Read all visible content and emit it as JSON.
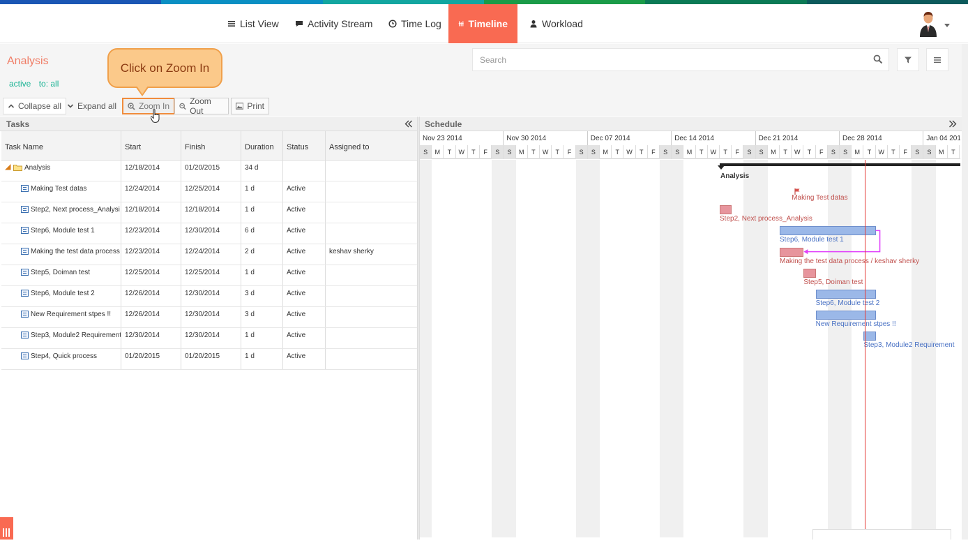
{
  "colors": {
    "stripe": [
      "#1a56b4",
      "#0a8fc3",
      "#12a6a0",
      "#1a9b48",
      "#0b7a55",
      "#0c5a5c"
    ],
    "accent": "#f96a52",
    "title": "#f07d66",
    "filter": "#1ab394",
    "task_bar_red": "#e7959d",
    "task_bar_blue": "#9bb8e8",
    "today_line": "#e53935"
  },
  "nav": {
    "items": [
      {
        "label": "List View",
        "icon": "list-icon"
      },
      {
        "label": "Activity Stream",
        "icon": "comment-icon"
      },
      {
        "label": "Time Log",
        "icon": "clock-icon"
      },
      {
        "label": "Timeline",
        "icon": "timeline-icon",
        "active": true
      },
      {
        "label": "Workload",
        "icon": "user-icon"
      }
    ]
  },
  "page": {
    "title": "Analysis",
    "filter_active": "active",
    "filter_to": "to: all",
    "search_placeholder": "Search"
  },
  "callout": {
    "text": "Click on Zoom In"
  },
  "toolbar": {
    "collapse_all": "Collapse all",
    "expand_all": "Expand all",
    "zoom_in": "Zoom In",
    "zoom_out": "Zoom Out",
    "print": "Print"
  },
  "tasks_panel": {
    "title": "Tasks",
    "columns": [
      "Task Name",
      "Start",
      "Finish",
      "Duration",
      "Status",
      "Assigned to"
    ],
    "rows": [
      {
        "name": "Analysis",
        "start": "12/18/2014",
        "finish": "01/20/2015",
        "duration": "34 d",
        "status": "",
        "assigned": "",
        "group": true
      },
      {
        "name": "Making Test datas",
        "start": "12/24/2014",
        "finish": "12/25/2014",
        "duration": "1 d",
        "status": "Active",
        "assigned": ""
      },
      {
        "name": "Step2, Next process_Analysi",
        "start": "12/18/2014",
        "finish": "12/18/2014",
        "duration": "1 d",
        "status": "Active",
        "assigned": ""
      },
      {
        "name": "Step6, Module test 1",
        "start": "12/23/2014",
        "finish": "12/30/2014",
        "duration": "6 d",
        "status": "Active",
        "assigned": ""
      },
      {
        "name": "Making the test data process",
        "start": "12/23/2014",
        "finish": "12/24/2014",
        "duration": "2 d",
        "status": "Active",
        "assigned": "keshav sherky"
      },
      {
        "name": "Step5, Doiman test",
        "start": "12/25/2014",
        "finish": "12/25/2014",
        "duration": "1 d",
        "status": "Active",
        "assigned": ""
      },
      {
        "name": "Step6, Module test 2",
        "start": "12/26/2014",
        "finish": "12/30/2014",
        "duration": "3 d",
        "status": "Active",
        "assigned": ""
      },
      {
        "name": "New Requirement stpes !!",
        "start": "12/26/2014",
        "finish": "12/30/2014",
        "duration": "3 d",
        "status": "Active",
        "assigned": ""
      },
      {
        "name": "Step3, Module2 Requirement",
        "start": "12/30/2014",
        "finish": "12/30/2014",
        "duration": "1 d",
        "status": "Active",
        "assigned": ""
      },
      {
        "name": "Step4, Quick process",
        "start": "01/20/2015",
        "finish": "01/20/2015",
        "duration": "1 d",
        "status": "Active",
        "assigned": ""
      }
    ]
  },
  "schedule": {
    "title": "Schedule",
    "weeks": [
      "Nov 23 2014",
      "Nov 30 2014",
      "Dec 07 2014",
      "Dec 14 2014",
      "Dec 21 2014",
      "Dec 28 2014",
      "Jan 04 201"
    ],
    "day_letters": [
      "S",
      "M",
      "T",
      "W",
      "T",
      "F",
      "S"
    ],
    "summary_label": "Analysis",
    "bar_labels": [
      {
        "text": "Making Test datas",
        "start": "2014-12-24",
        "end": "2014-12-24",
        "color": "red",
        "milestone": true
      },
      {
        "text": "Step2, Next process_Analysis",
        "start": "2014-12-18",
        "end": "2014-12-18",
        "color": "red"
      },
      {
        "text": "Step6, Module test 1",
        "start": "2014-12-23",
        "end": "2014-12-30",
        "color": "blue"
      },
      {
        "text": "Making the test data process / keshav sherky",
        "start": "2014-12-23",
        "end": "2014-12-24",
        "color": "red"
      },
      {
        "text": "Step5, Doiman test",
        "start": "2014-12-25",
        "end": "2014-12-25",
        "color": "red"
      },
      {
        "text": "Step6, Module test 2",
        "start": "2014-12-26",
        "end": "2014-12-30",
        "color": "blue"
      },
      {
        "text": "New Requirement stpes !!",
        "start": "2014-12-26",
        "end": "2014-12-30",
        "color": "blue"
      },
      {
        "text": "Step3, Module2 Requirement",
        "start": "2014-12-30",
        "end": "2014-12-30",
        "color": "blue"
      }
    ],
    "today": "2014-12-30"
  }
}
